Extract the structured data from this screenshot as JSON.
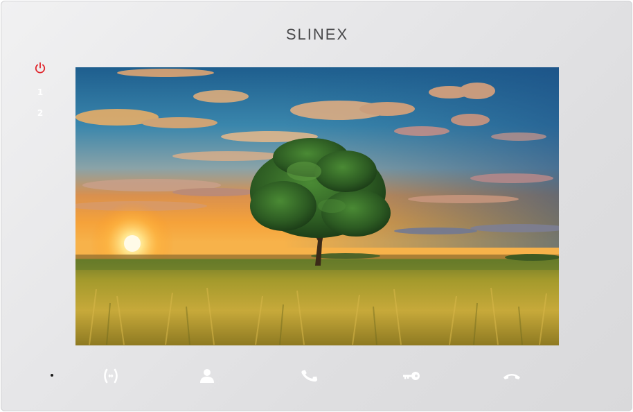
{
  "device": {
    "brand": "SLINEX",
    "line_labels": [
      "1",
      "2"
    ],
    "power_indicator_color": "#e0242b"
  },
  "screen": {
    "content": "landscape-image"
  },
  "buttons": [
    {
      "id": "switch",
      "icon": "monitor-switch-icon"
    },
    {
      "id": "user",
      "icon": "user-icon"
    },
    {
      "id": "answer",
      "icon": "phone-answer-icon"
    },
    {
      "id": "unlock",
      "icon": "key-icon"
    },
    {
      "id": "hangup",
      "icon": "phone-hangup-icon"
    }
  ]
}
